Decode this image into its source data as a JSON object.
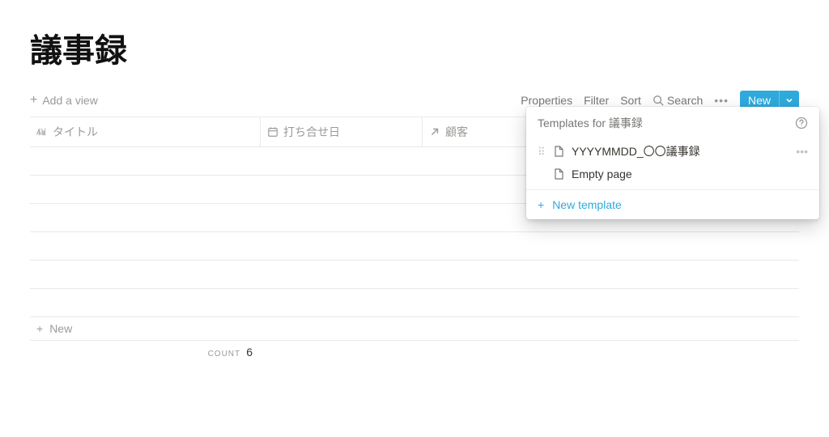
{
  "page": {
    "title": "議事録"
  },
  "toolbar": {
    "add_view": "Add a view",
    "properties": "Properties",
    "filter": "Filter",
    "sort": "Sort",
    "search": "Search",
    "new_label": "New"
  },
  "columns": {
    "title": "タイトル",
    "date": "打ち合せ日",
    "customer": "顧客"
  },
  "rows": {
    "empty_count": 6
  },
  "footer": {
    "new_row": "New",
    "count_label": "COUNT",
    "count_value": "6"
  },
  "dropdown": {
    "header": "Templates for 議事録",
    "template_label": "YYYYMMDD_〇〇議事録",
    "empty_label": "Empty page",
    "new_template": "New template"
  }
}
